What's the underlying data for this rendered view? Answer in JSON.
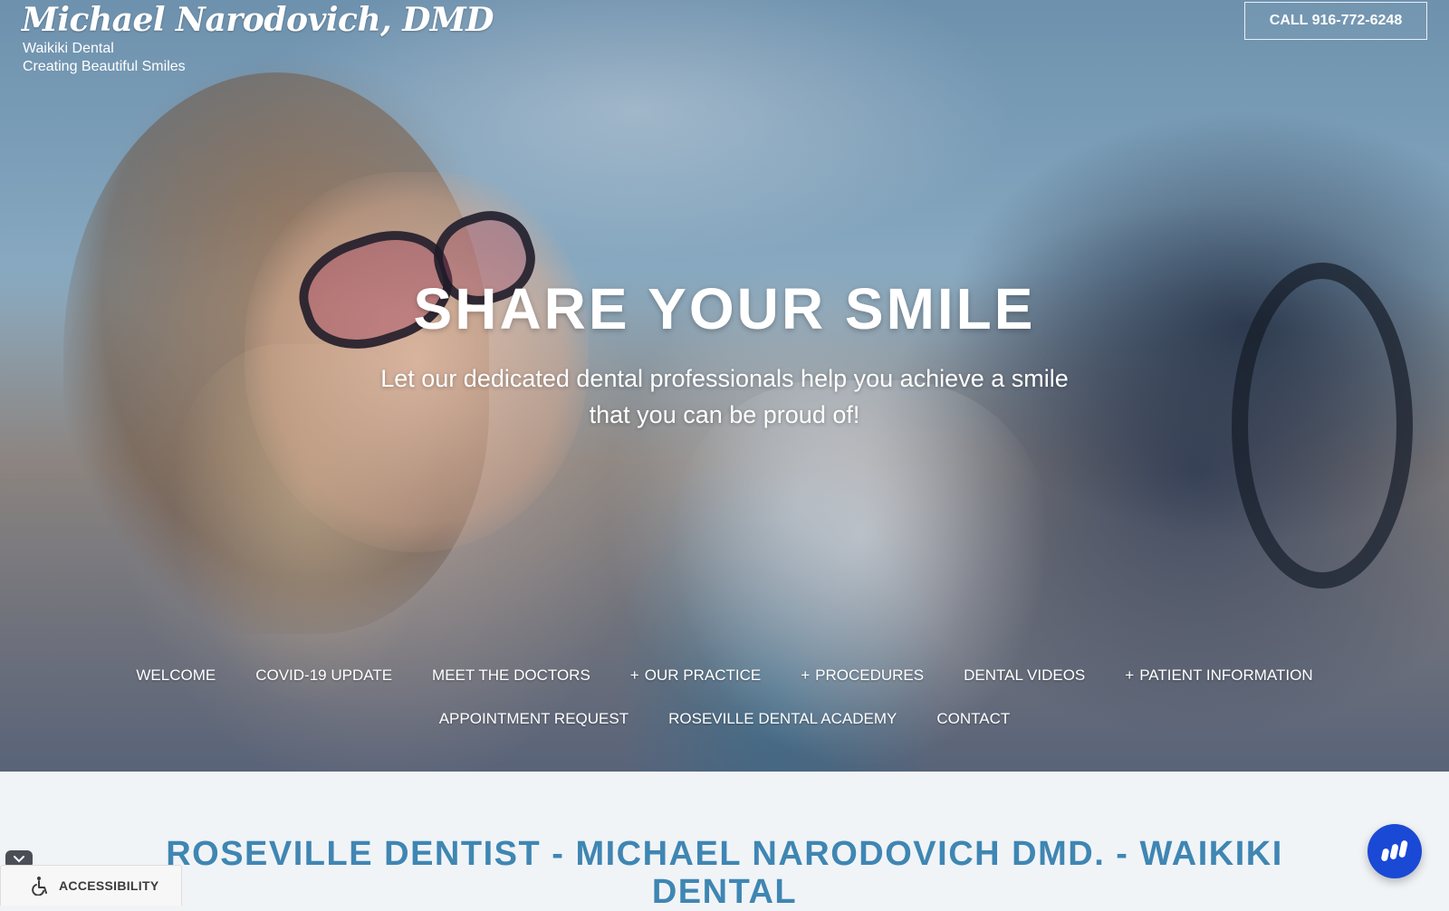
{
  "header": {
    "brand_name": "Michael Narodovich, DMD",
    "brand_line1": "Waikiki Dental",
    "brand_line2": "Creating Beautiful Smiles",
    "call_button": "CALL 916-772-6248"
  },
  "hero": {
    "title": "SHARE YOUR SMILE",
    "subtitle": "Let our dedicated dental professionals help you achieve a smile that you can be proud of!"
  },
  "nav": {
    "items": [
      {
        "label": "WELCOME",
        "plus": ""
      },
      {
        "label": "COVID-19 UPDATE",
        "plus": ""
      },
      {
        "label": "MEET THE DOCTORS",
        "plus": ""
      },
      {
        "label": "OUR PRACTICE",
        "plus": "+"
      },
      {
        "label": "PROCEDURES",
        "plus": "+"
      },
      {
        "label": "DENTAL VIDEOS",
        "plus": ""
      },
      {
        "label": "PATIENT INFORMATION",
        "plus": "+"
      },
      {
        "label": "APPOINTMENT REQUEST",
        "plus": ""
      },
      {
        "label": "ROSEVILLE DENTAL ACADEMY",
        "plus": ""
      },
      {
        "label": "CONTACT",
        "plus": ""
      }
    ]
  },
  "content": {
    "heading": "ROSEVILLE DENTIST - MICHAEL NARODOVICH DMD. - WAIKIKI DENTAL"
  },
  "accessibility": {
    "label": "ACCESSIBILITY",
    "icon": "wheelchair-icon",
    "toggle_icon": "chevron-down-icon"
  },
  "chat": {
    "icon": "chat-bars-icon"
  },
  "colors": {
    "heading": "#3f86b3",
    "chat_button": "#1a49d6",
    "accessibility_bar": "#f7f7f7"
  }
}
